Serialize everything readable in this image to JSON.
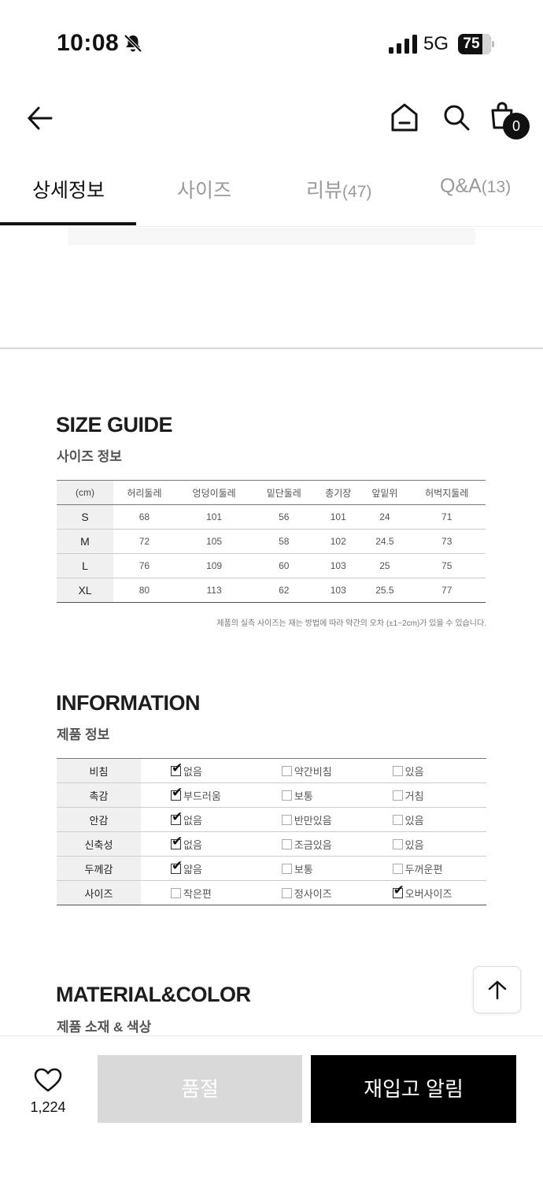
{
  "status_bar": {
    "time": "10:08",
    "network": "5G",
    "battery": "75",
    "battery_level": 0.75
  },
  "header": {
    "cart_count": "0"
  },
  "tabs": [
    {
      "label": "상세정보",
      "count": ""
    },
    {
      "label": "사이즈",
      "count": ""
    },
    {
      "label": "리뷰",
      "count": "(47)"
    },
    {
      "label": "Q&A",
      "count": "(13)"
    }
  ],
  "size_guide": {
    "title": "SIZE GUIDE",
    "subtitle": "사이즈 정보",
    "columns": [
      "(cm)",
      "허리둘레",
      "엉덩이둘레",
      "밑단둘레",
      "총기장",
      "앞밑위",
      "허벅지둘레"
    ],
    "rows": [
      [
        "S",
        "68",
        "101",
        "56",
        "101",
        "24",
        "71"
      ],
      [
        "M",
        "72",
        "105",
        "58",
        "102",
        "24.5",
        "73"
      ],
      [
        "L",
        "76",
        "109",
        "60",
        "103",
        "25",
        "75"
      ],
      [
        "XL",
        "80",
        "113",
        "62",
        "103",
        "25.5",
        "77"
      ]
    ],
    "note": "제품의 실측 사이즈는 재는 방법에 따라 약간의 오차 (±1~2cm)가 있을 수 있습니다."
  },
  "information": {
    "title": "INFORMATION",
    "subtitle": "제품 정보",
    "rows": [
      {
        "label": "비침",
        "options": [
          "없음",
          "약간비침",
          "있음"
        ],
        "checked": 0
      },
      {
        "label": "촉감",
        "options": [
          "부드러움",
          "보통",
          "거침"
        ],
        "checked": 0
      },
      {
        "label": "안감",
        "options": [
          "없음",
          "반만있음",
          "있음"
        ],
        "checked": 0
      },
      {
        "label": "신축성",
        "options": [
          "없음",
          "조금있음",
          "있음"
        ],
        "checked": 0
      },
      {
        "label": "두께감",
        "options": [
          "얇음",
          "보통",
          "두꺼운편"
        ],
        "checked": 0
      },
      {
        "label": "사이즈",
        "options": [
          "작은편",
          "정사이즈",
          "오버사이즈"
        ],
        "checked": 2
      }
    ]
  },
  "material": {
    "title": "MATERIAL&COLOR",
    "subtitle": "제품 소재 & 색상"
  },
  "bottom_bar": {
    "like_count": "1,224",
    "soldout_label": "품절",
    "restock_label": "재입고 알림"
  },
  "icons": [
    "bell-slash-icon",
    "signal-icon",
    "back-arrow-icon",
    "home-icon",
    "search-icon",
    "cart-icon",
    "arrow-up-icon",
    "heart-icon"
  ]
}
